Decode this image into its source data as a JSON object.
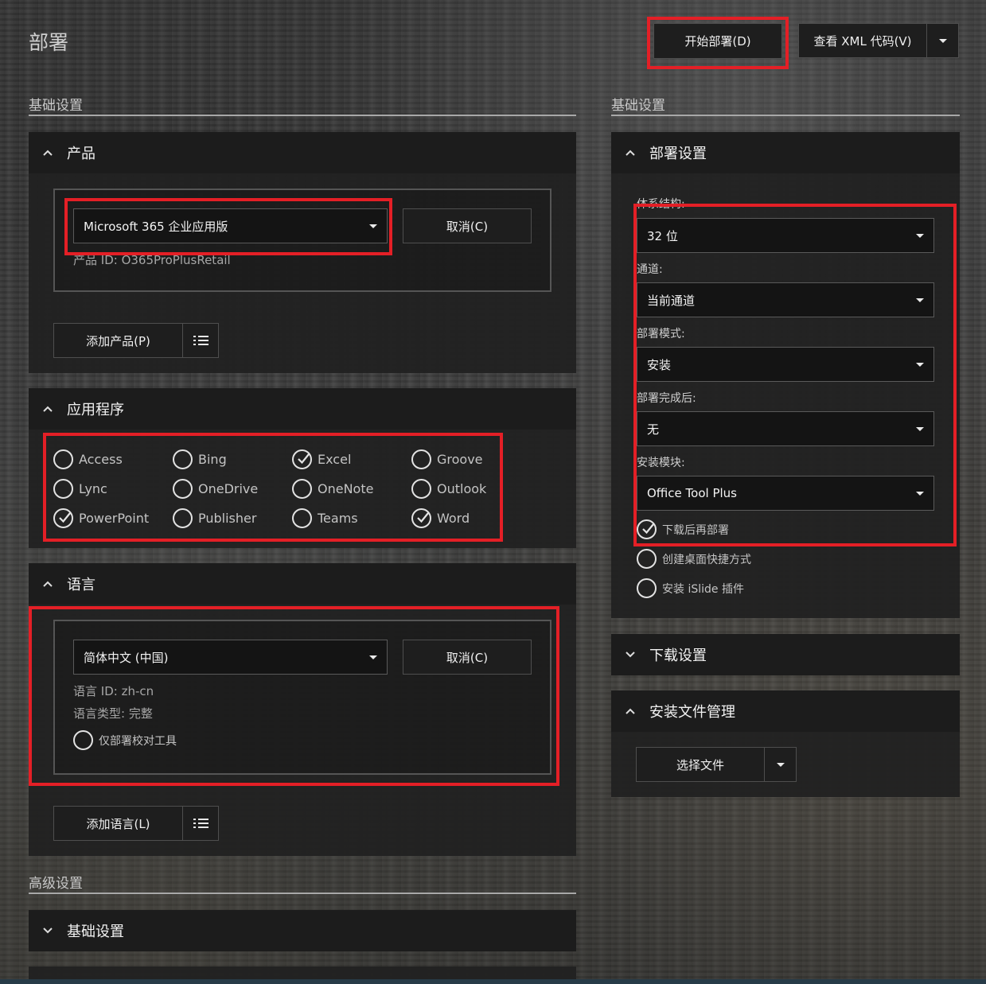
{
  "page_title": "部署",
  "header": {
    "start_deploy": "开始部署(D)",
    "view_xml": "查看 XML 代码(V)"
  },
  "left": {
    "section_basic": "基础设置",
    "products": {
      "title": "产品",
      "selected": "Microsoft 365 企业应用版",
      "cancel": "取消(C)",
      "product_id": "产品 ID: O365ProPlusRetail",
      "add": "添加产品(P)"
    },
    "apps": {
      "title": "应用程序",
      "items": [
        {
          "label": "Access",
          "checked": false
        },
        {
          "label": "Bing",
          "checked": false
        },
        {
          "label": "Excel",
          "checked": true
        },
        {
          "label": "Groove",
          "checked": false
        },
        {
          "label": "Lync",
          "checked": false
        },
        {
          "label": "OneDrive",
          "checked": false
        },
        {
          "label": "OneNote",
          "checked": false
        },
        {
          "label": "Outlook",
          "checked": false
        },
        {
          "label": "PowerPoint",
          "checked": true
        },
        {
          "label": "Publisher",
          "checked": false
        },
        {
          "label": "Teams",
          "checked": false
        },
        {
          "label": "Word",
          "checked": true
        }
      ]
    },
    "language": {
      "title": "语言",
      "selected": "简体中文 (中国)",
      "cancel": "取消(C)",
      "id": "语言 ID: zh-cn",
      "type": "语言类型: 完整",
      "proofing_only": "仅部署校对工具",
      "add": "添加语言(L)"
    },
    "section_advanced": "高级设置",
    "advanced_basic": "基础设置"
  },
  "right": {
    "section_basic": "基础设置",
    "deploy": {
      "title": "部署设置",
      "arch_label": "体系结构:",
      "arch_value": "32 位",
      "channel_label": "通道:",
      "channel_value": "当前通道",
      "mode_label": "部署模式:",
      "mode_value": "安装",
      "after_label": "部署完成后:",
      "after_value": "无",
      "module_label": "安装模块:",
      "module_value": "Office Tool Plus",
      "opt_download_then_deploy": "下载后再部署",
      "opt_desktop_shortcut": "创建桌面快捷方式",
      "opt_islide": "安装 iSlide 插件"
    },
    "download": {
      "title": "下载设置"
    },
    "install_files": {
      "title": "安装文件管理",
      "choose_file": "选择文件"
    }
  }
}
